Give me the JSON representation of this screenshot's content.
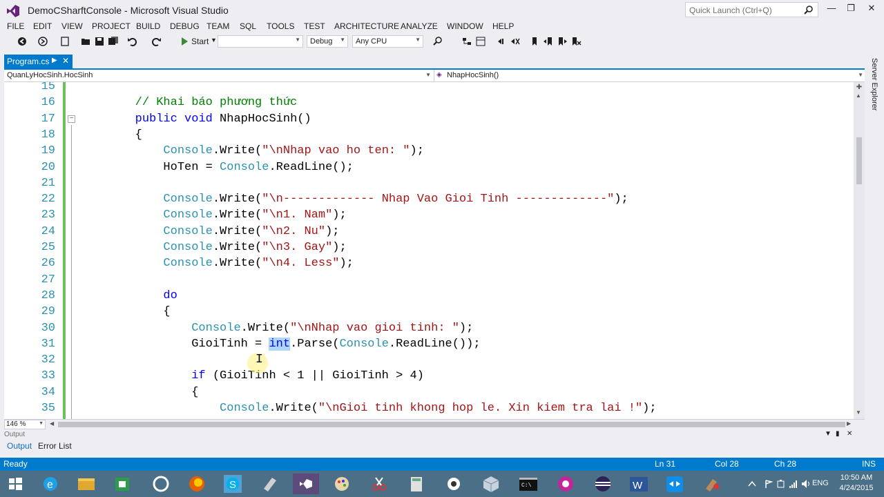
{
  "window": {
    "title": "DemoCSharftConsole - Microsoft Visual Studio",
    "quick_launch_placeholder": "Quick Launch (Ctrl+Q)"
  },
  "menu": [
    "FILE",
    "EDIT",
    "VIEW",
    "PROJECT",
    "BUILD",
    "DEBUG",
    "TEAM",
    "SQL",
    "TOOLS",
    "TEST",
    "ARCHITECTURE",
    "ANALYZE",
    "WINDOW",
    "HELP"
  ],
  "toolbar": {
    "start_label": "Start",
    "config": "Debug",
    "platform": "Any CPU"
  },
  "tab": {
    "name": "Program.cs"
  },
  "navbar": {
    "left": "QuanLyHocSinh.HocSinh",
    "right": "NhapHocSinh()"
  },
  "editor": {
    "lines": [
      {
        "n": "15",
        "code": ""
      },
      {
        "n": "16",
        "code": "        // Khai báo phương thức"
      },
      {
        "n": "17",
        "code": "        public void NhapHocSinh()"
      },
      {
        "n": "18",
        "code": "        {"
      },
      {
        "n": "19",
        "code": "            Console.Write(\"\\nNhap vao ho ten: \");"
      },
      {
        "n": "20",
        "code": "            HoTen = Console.ReadLine();"
      },
      {
        "n": "21",
        "code": ""
      },
      {
        "n": "22",
        "code": "            Console.Write(\"\\n------------- Nhap Vao Gioi Tinh -------------\");"
      },
      {
        "n": "23",
        "code": "            Console.Write(\"\\n1. Nam\");"
      },
      {
        "n": "24",
        "code": "            Console.Write(\"\\n2. Nu\");"
      },
      {
        "n": "25",
        "code": "            Console.Write(\"\\n3. Gay\");"
      },
      {
        "n": "26",
        "code": "            Console.Write(\"\\n4. Less\");"
      },
      {
        "n": "27",
        "code": ""
      },
      {
        "n": "28",
        "code": "            do"
      },
      {
        "n": "29",
        "code": "            {"
      },
      {
        "n": "30",
        "code": "                Console.Write(\"\\nNhap vao gioi tinh: \");"
      },
      {
        "n": "31",
        "code": "                GioiTinh = int.Parse(Console.ReadLine());"
      },
      {
        "n": "32",
        "code": ""
      },
      {
        "n": "33",
        "code": "                if (GioiTinh < 1 || GioiTinh > 4)"
      },
      {
        "n": "34",
        "code": "                {"
      },
      {
        "n": "35",
        "code": "                    Console.Write(\"\\nGioi tinh khong hop le. Xin kiem tra lai !\");"
      }
    ],
    "zoom": "146 %"
  },
  "output": {
    "header": "Output",
    "tabs": [
      "Output",
      "Error List"
    ]
  },
  "sidebar": {
    "server_explorer": "Server Explorer"
  },
  "status": {
    "state": "Ready",
    "line": "Ln 31",
    "col": "Col 28",
    "ch": "Ch 28",
    "mode": "INS"
  },
  "taskbar": {
    "lang": "ENG",
    "time": "10:50 AM",
    "date": "4/24/2015"
  },
  "colors": {
    "accent": "#007ACC",
    "keyword": "#0000FF",
    "string": "#A31515",
    "type": "#2B91AF",
    "comment": "#008000"
  }
}
